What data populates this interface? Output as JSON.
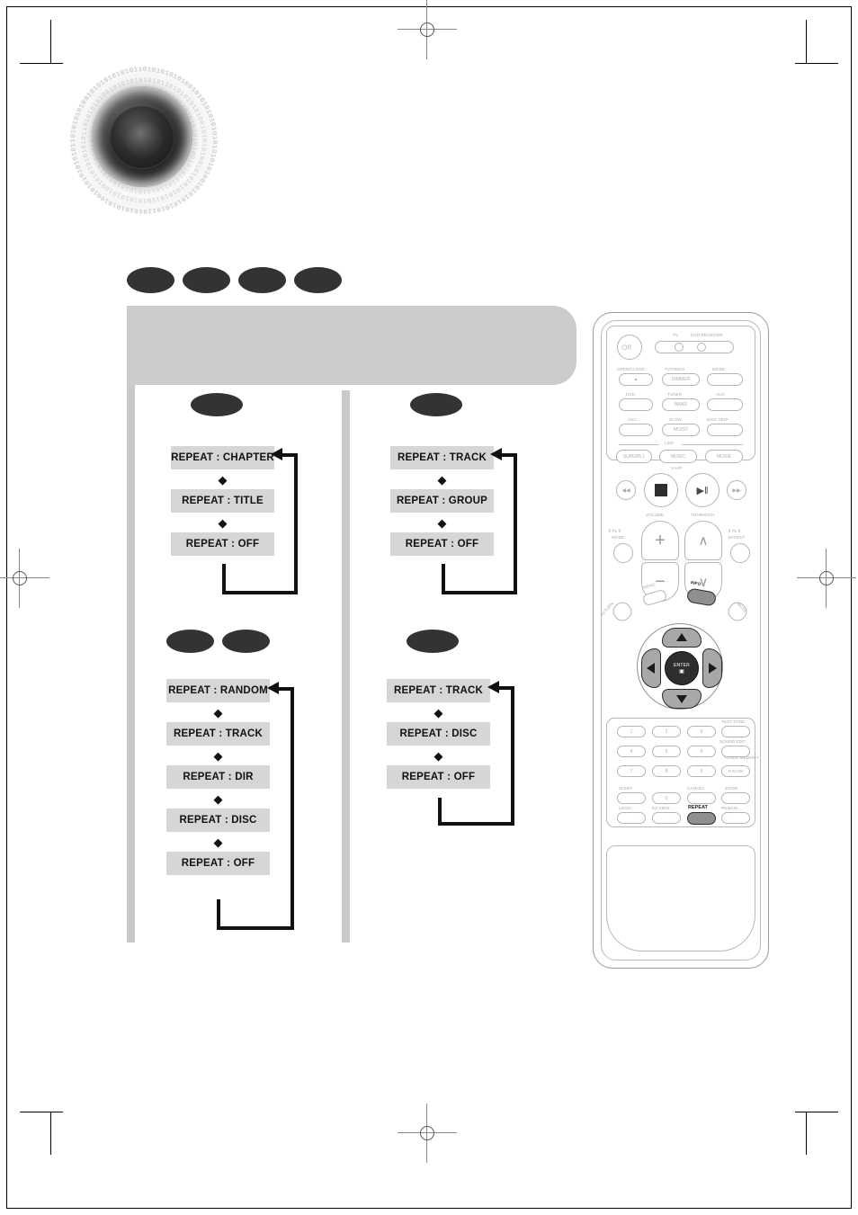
{
  "page": {
    "type": "scanned-manual-page",
    "print_marks": {
      "registration_icon": "registration-crosshair",
      "crop_marks": "corner-crop-marks"
    },
    "decorative": {
      "speaker_graphic": "speaker-cone-graphic",
      "binary_ring_text": "01010101001010101010101101010101010010101010101011"
    }
  },
  "header": {
    "banner_text": "",
    "disc_badges": [
      {
        "name": "disc-badge-1",
        "label": ""
      },
      {
        "name": "disc-badge-2",
        "label": ""
      },
      {
        "name": "disc-badge-3",
        "label": ""
      },
      {
        "name": "disc-badge-4",
        "label": ""
      }
    ]
  },
  "flowcharts": [
    {
      "id": "repeat-flow-dvd",
      "position": "top-left",
      "badges": [
        {
          "label": ""
        }
      ],
      "steps": [
        {
          "label": "REPEAT : CHAPTER"
        },
        {
          "label": "REPEAT : TITLE"
        },
        {
          "label": "REPEAT : OFF"
        }
      ],
      "loop": "REPEAT : OFF -> REPEAT : CHAPTER",
      "arrow_glyph": "◆"
    },
    {
      "id": "repeat-flow-dvd-audio",
      "position": "top-right",
      "badges": [
        {
          "label": ""
        }
      ],
      "steps": [
        {
          "label": "REPEAT : TRACK"
        },
        {
          "label": "REPEAT : GROUP"
        },
        {
          "label": "REPEAT : OFF"
        }
      ],
      "loop": "REPEAT : OFF -> REPEAT : TRACK",
      "arrow_glyph": "◆"
    },
    {
      "id": "repeat-flow-mp3-jpeg",
      "position": "bottom-left",
      "badges": [
        {
          "label": ""
        },
        {
          "label": ""
        }
      ],
      "steps": [
        {
          "label": "REPEAT : RANDOM"
        },
        {
          "label": "REPEAT : TRACK"
        },
        {
          "label": "REPEAT : DIR"
        },
        {
          "label": "REPEAT : DISC"
        },
        {
          "label": "REPEAT : OFF"
        }
      ],
      "loop": "REPEAT : OFF -> REPEAT : RANDOM",
      "arrow_glyph": "◆"
    },
    {
      "id": "repeat-flow-cd",
      "position": "bottom-right",
      "badges": [
        {
          "label": ""
        }
      ],
      "steps": [
        {
          "label": "REPEAT : TRACK"
        },
        {
          "label": "REPEAT : DISC"
        },
        {
          "label": "REPEAT : OFF"
        }
      ],
      "loop": "REPEAT : OFF -> REPEAT : TRACK",
      "arrow_glyph": "◆"
    }
  ],
  "remote": {
    "name": "dvd-receiver-remote-control",
    "power": {
      "label": "",
      "icon": "power-icon",
      "glyph": "⏻/I"
    },
    "device_indicators": {
      "tv": "TV",
      "dvd_receiver": "DVD RECEIVER"
    },
    "top_buttons": [
      {
        "name": "open-close-button",
        "label": "OPEN/CLOSE",
        "sub": "▲"
      },
      {
        "name": "tv-video-dimmer-button",
        "label": "TV/VIDEO",
        "sub": "DIMMER"
      },
      {
        "name": "mode-button",
        "label": "MODE",
        "sub": ""
      },
      {
        "name": "dvd-button",
        "label": "DVD",
        "sub": ""
      },
      {
        "name": "tuner-band-button",
        "label": "TUNER",
        "sub": "BAND"
      },
      {
        "name": "aux-button",
        "label": "AUX",
        "sub": ""
      },
      {
        "name": "asc-button",
        "label": "ASC",
        "sub": ""
      },
      {
        "name": "slow-moist-button",
        "label": "SLOW",
        "sub": "MO/ST"
      },
      {
        "name": "disc-skip-button",
        "label": "DISC SKIP",
        "sub": ""
      }
    ],
    "lsm": {
      "group_label": "LSM",
      "buttons": [
        {
          "name": "super51-button",
          "label": "SUPER5.1"
        },
        {
          "name": "music-button",
          "label": "MUSIC"
        },
        {
          "name": "movie-button",
          "label": "MOVIE"
        }
      ],
      "footer_label": "V-H/P"
    },
    "transport": [
      {
        "name": "previous-button",
        "glyph": "◀◀",
        "label": ""
      },
      {
        "name": "stop-button",
        "glyph": "■",
        "label": ""
      },
      {
        "name": "play-pause-button",
        "glyph": "▶‖",
        "label": ""
      },
      {
        "name": "next-button",
        "glyph": "▶▶",
        "label": ""
      }
    ],
    "volume": {
      "label": "VOLUME",
      "plus": "+",
      "minus": "−"
    },
    "tuning": {
      "label": "TUNING/CH",
      "up": "∧",
      "down": "∨"
    },
    "pl_mode": {
      "label": "MODE",
      "prefix": "Ⅱ PL Ⅱ"
    },
    "pl_effect": {
      "label": "EFFECT",
      "prefix": "Ⅱ PL Ⅱ"
    },
    "nav_cluster": {
      "menu": "MENU",
      "info": "INFO",
      "return": "RETURN",
      "mute": "MUTE",
      "enter": "ENTER",
      "enter_sub": "▣",
      "up": "▲",
      "down": "▼",
      "left": "◀",
      "right": "▶"
    },
    "keypad": {
      "numbers": [
        "1",
        "2",
        "3",
        "4",
        "5",
        "6",
        "7",
        "8",
        "9",
        "0"
      ],
      "right_column": [
        {
          "name": "test-tone-button",
          "label": "TEST TONE"
        },
        {
          "name": "sound-edit-button",
          "label": "SOUND EDIT"
        },
        {
          "name": "tuner-memory-button",
          "label": "TUNER MEMORY",
          "sub": "P.SCAN"
        },
        {
          "name": "zoom-button",
          "label": "ZOOM"
        },
        {
          "name": "remain-button",
          "label": "REMAIN"
        }
      ],
      "bottom_rows": [
        {
          "name": "sleep-button",
          "label": "SLEEP"
        },
        {
          "name": "cancel-button",
          "label": "CANCEL"
        },
        {
          "name": "logo-button",
          "label": "LOGO"
        },
        {
          "name": "ez-view-button",
          "label": "EZ VIEW"
        },
        {
          "name": "repeat-button",
          "label": "REPEAT",
          "highlighted": true
        }
      ]
    }
  },
  "colors": {
    "banner_gray": "#cccccc",
    "box_gray": "#d6d6d6",
    "badge_dark": "#333333",
    "remote_outline": "#9b9b9b",
    "highlight_button": "#8f8f8f"
  }
}
